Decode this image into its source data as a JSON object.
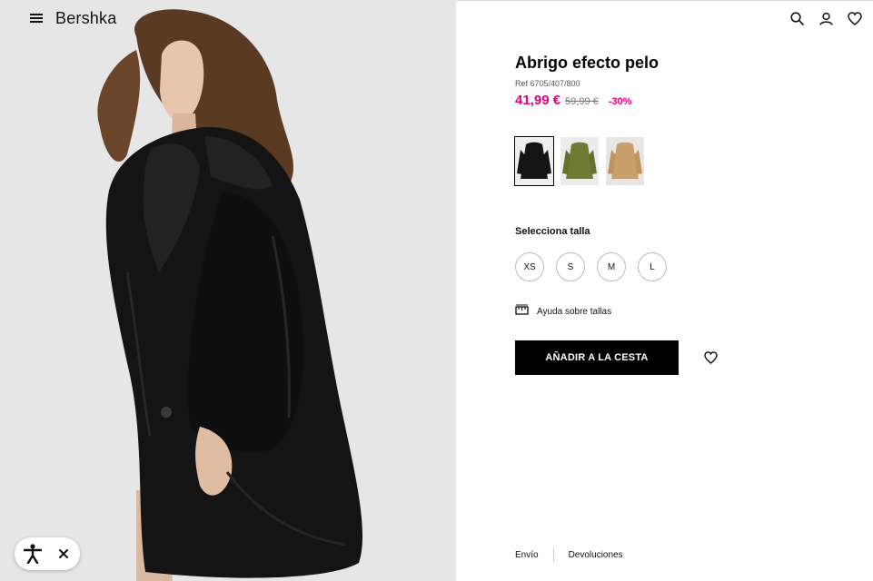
{
  "header": {
    "brand": "Bershka",
    "icons": [
      "menu-icon",
      "search-icon",
      "user-icon",
      "heart-icon"
    ]
  },
  "product": {
    "title": "Abrigo efecto pelo",
    "ref": "Ref 6705/407/800",
    "price": "41,99 €",
    "old_price": "59,99 €",
    "discount": "-30%",
    "colors": [
      {
        "name": "black",
        "hex": "#141414",
        "selected": true
      },
      {
        "name": "green",
        "hex": "#6f7a35",
        "selected": false
      },
      {
        "name": "camel",
        "hex": "#c9a06c",
        "selected": false
      }
    ],
    "size_label": "Selecciona talla",
    "sizes": [
      "XS",
      "S",
      "M",
      "L"
    ],
    "size_help": "Ayuda sobre tallas",
    "add_to_cart": "AÑADIR A LA CESTA"
  },
  "footer": {
    "shipping": "Envío",
    "returns": "Devoluciones"
  },
  "colors": {
    "accent": "#e6007e",
    "button_bg": "#000000",
    "image_bg": "#e6e6e7"
  }
}
